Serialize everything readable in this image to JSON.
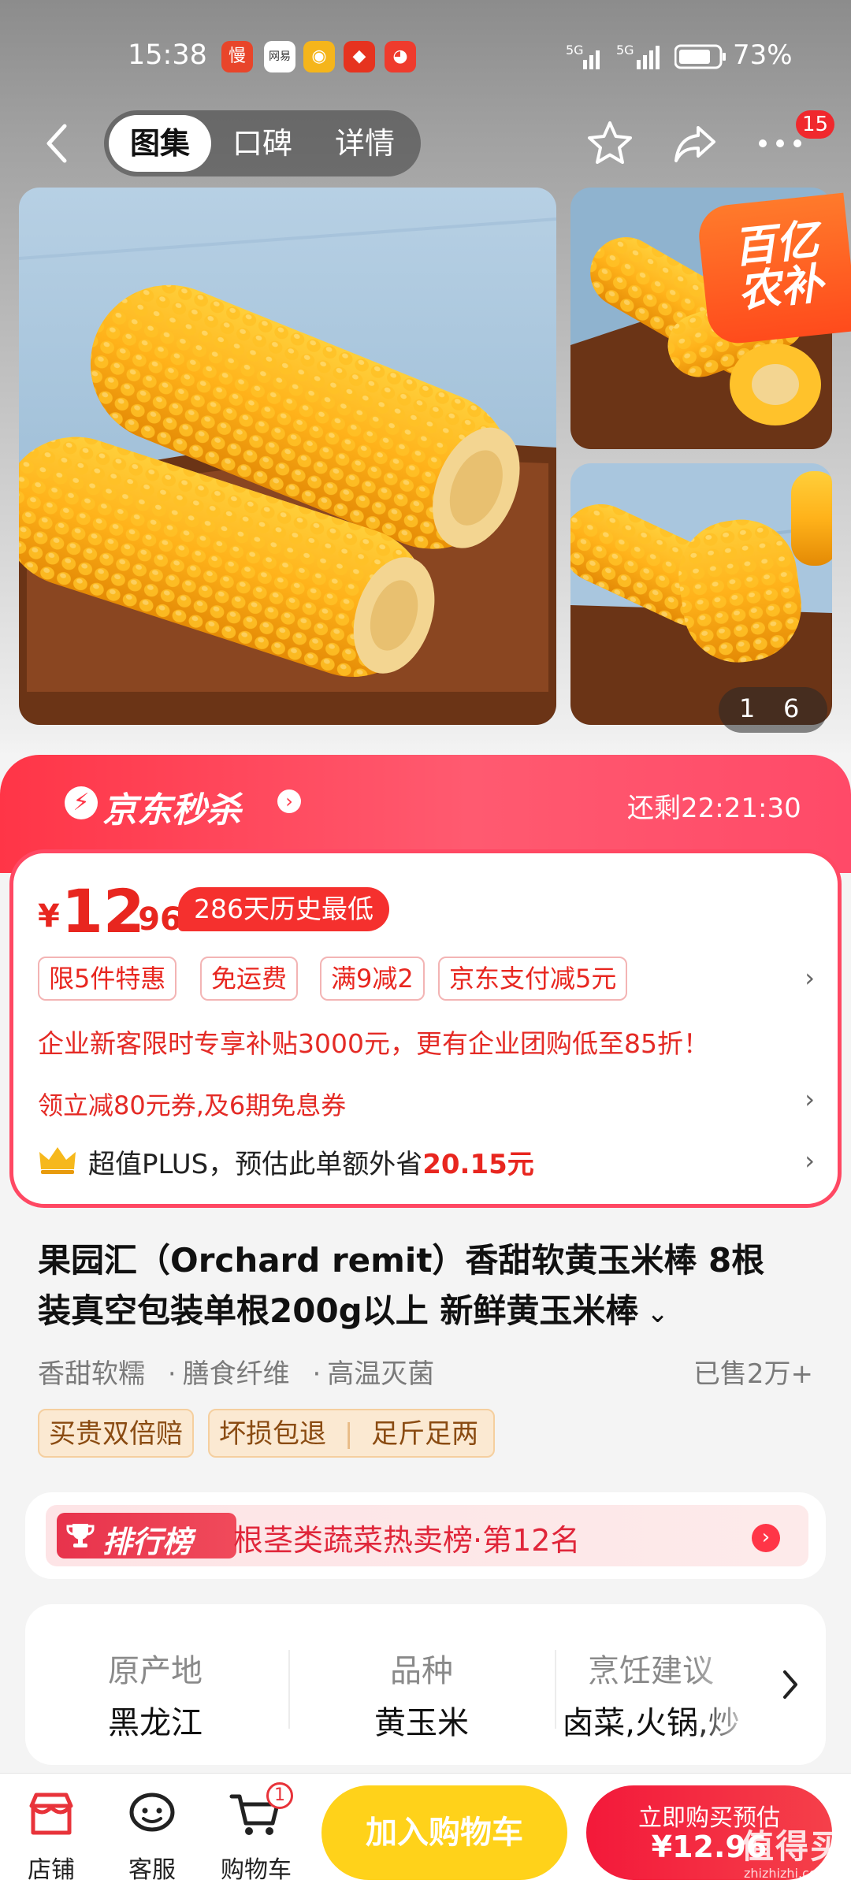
{
  "status_bar": {
    "time": "15:38",
    "net1": "5G",
    "net2": "5G",
    "battery_percent": "73%",
    "app_icons": [
      {
        "name": "app-icon-1",
        "glyph": "慢",
        "color": "#e8452a"
      },
      {
        "name": "app-icon-2",
        "glyph": "网易",
        "color": "#ffffff"
      },
      {
        "name": "app-icon-3",
        "glyph": "◉",
        "color": "#f5b51b"
      },
      {
        "name": "app-icon-4",
        "glyph": "◆",
        "color": "#e6331f"
      },
      {
        "name": "app-icon-5",
        "glyph": "◕",
        "color": "#ef3b2d"
      }
    ]
  },
  "nav": {
    "tabs": [
      "图集",
      "口碑",
      "详情"
    ],
    "active_tab": "图集",
    "more_badge": "15"
  },
  "gallery": {
    "badge_line1": "百亿",
    "badge_line2": "农补",
    "index_current": "1",
    "index_total": "6"
  },
  "flash_sale": {
    "brand": "京东秒杀",
    "countdown_label": "还剩",
    "countdown": "22:21:30"
  },
  "price": {
    "currency": "¥",
    "integer": "12",
    "decimal": ".96",
    "history_badge": "286天历史最低"
  },
  "promo_chips": [
    "限5件特惠",
    "免运费",
    "满9减2",
    "京东支付减5元"
  ],
  "promo_lines": {
    "enterprise": "企业新客限时专享补贴3000元，更有企业团购低至85折！",
    "coupon": "领立减80元券,及6期免息券",
    "plus_prefix": "超值PLUS，预估此单额外省",
    "plus_amount": "20.15元"
  },
  "product": {
    "title_line1": "果园汇（Orchard remit）香甜软黄玉米棒 8根",
    "title_line2": "装真空包装单根200g以上 新鲜黄玉米棒",
    "features": [
      "香甜软糯",
      "膳食纤维",
      "高温灭菌"
    ],
    "sold": "已售2万+",
    "service_tags": [
      "买贵双倍赔",
      "坏损包退",
      "足斤足两"
    ]
  },
  "ranking": {
    "badge": "排行榜",
    "text": "根茎类蔬菜热卖榜·第12名"
  },
  "attributes": [
    {
      "label": "原产地",
      "value": "黑龙江"
    },
    {
      "label": "品种",
      "value": "黄玉米"
    },
    {
      "label": "烹饪建议",
      "value": "卤菜,火锅,炒"
    }
  ],
  "bottom_bar": {
    "shop": "店铺",
    "service": "客服",
    "cart": "购物车",
    "cart_badge": "1",
    "add_to_cart": "加入购物车",
    "buy_now": "立即购买预估",
    "buy_price": "¥12.96"
  },
  "watermark": {
    "text": "值得买",
    "url": "zhizhizhi.com"
  },
  "colors": {
    "accent_red": "#ff3547",
    "price_red": "#e8261f",
    "add_cart_yellow": "#ffd21a",
    "buy_red": "#f1243b"
  }
}
